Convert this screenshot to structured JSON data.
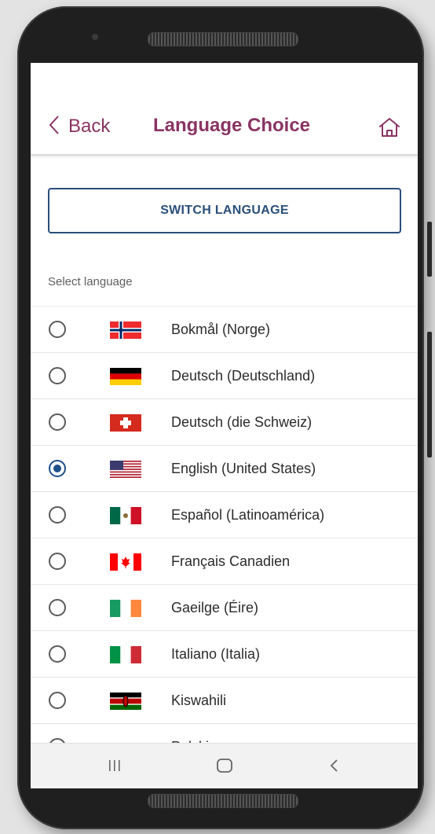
{
  "header": {
    "back_label": "Back",
    "title": "Language Choice",
    "home_icon": "home-icon",
    "title_color": "#8a3463"
  },
  "switch_button": {
    "label": "SWITCH LANGUAGE",
    "color": "#2a4f7a"
  },
  "section_label": "Select language",
  "languages": [
    {
      "label": "Bokmål (Norge)",
      "flag": "norway-flag",
      "selected": false
    },
    {
      "label": "Deutsch (Deutschland)",
      "flag": "germany-flag",
      "selected": false
    },
    {
      "label": "Deutsch (die Schweiz)",
      "flag": "switzerland-flag",
      "selected": false
    },
    {
      "label": "English (United States)",
      "flag": "usa-flag",
      "selected": true
    },
    {
      "label": "Español (Latinoamérica)",
      "flag": "mexico-flag",
      "selected": false
    },
    {
      "label": "Français Canadien",
      "flag": "canada-flag",
      "selected": false
    },
    {
      "label": "Gaeilge (Éire)",
      "flag": "ireland-flag",
      "selected": false
    },
    {
      "label": "Italiano (Italia)",
      "flag": "italy-flag",
      "selected": false
    },
    {
      "label": "Kiswahili",
      "flag": "kenya-flag",
      "selected": false
    },
    {
      "label": "Polski",
      "flag": "poland-flag",
      "selected": false
    }
  ],
  "navbar": {
    "recents_icon": "recents-icon",
    "home_icon": "home-pill-icon",
    "back_icon": "back-chevron-icon"
  }
}
